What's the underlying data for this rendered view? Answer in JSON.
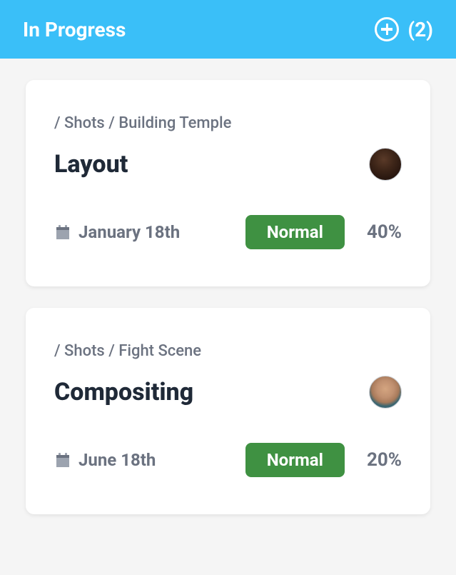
{
  "header": {
    "title": "In Progress",
    "count": "(2)"
  },
  "cards": [
    {
      "breadcrumb": "/ Shots / Building Temple",
      "title": "Layout",
      "date": "January 18th",
      "priority": "Normal",
      "percent": "40%"
    },
    {
      "breadcrumb": "/ Shots / Fight Scene",
      "title": "Compositing",
      "date": "June 18th",
      "priority": "Normal",
      "percent": "20%"
    }
  ]
}
